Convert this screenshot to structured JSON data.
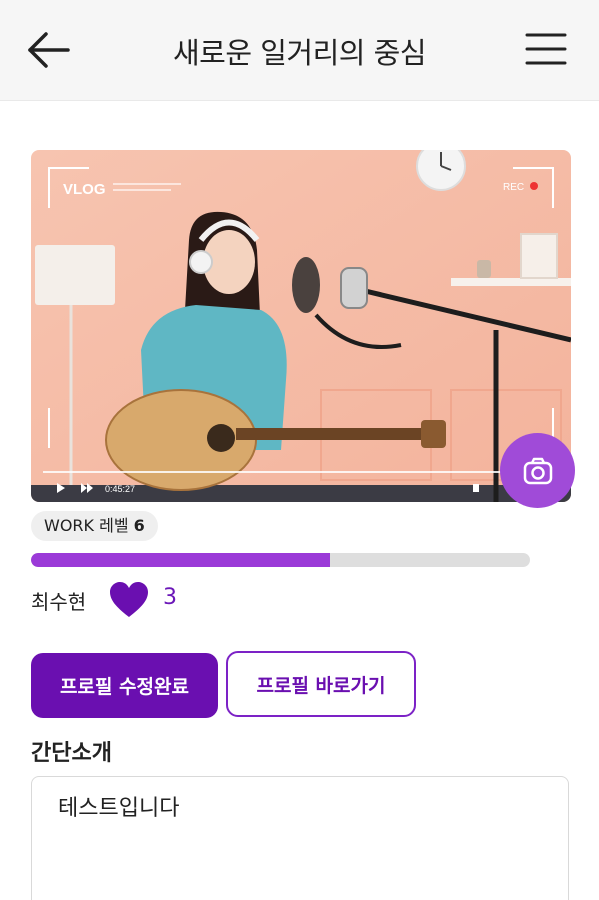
{
  "header": {
    "title": "새로운 일거리의 중심",
    "back_icon": "arrow-left-icon",
    "menu_icon": "hamburger-menu-icon"
  },
  "media": {
    "overlay_label": "VLOG",
    "rec_label": "REC",
    "timestamp": "0:45:27",
    "camera_icon": "camera-icon"
  },
  "profile": {
    "level_prefix": "WORK 레벨",
    "level_value": "6",
    "level_progress_fraction": 0.6,
    "name": "최수현",
    "like_icon": "heart-icon",
    "like_count": "3"
  },
  "actions": {
    "edit_done_label": "프로필 수정완료",
    "goto_profile_label": "프로필 바로가기"
  },
  "intro": {
    "label": "간단소개",
    "text": "테스트입니다"
  },
  "colors": {
    "accent": "#6a0fb0",
    "accent_light": "#a04bd8",
    "progress": "#9b3ad8",
    "header_bg": "#f6f6f6"
  }
}
